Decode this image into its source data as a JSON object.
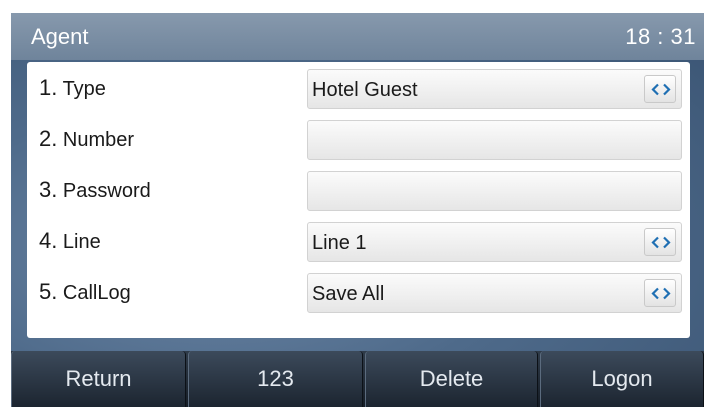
{
  "header": {
    "title": "Agent",
    "time": "18 : 31"
  },
  "rows": [
    {
      "num": "1.",
      "label": "Type",
      "value": "Hotel Guest",
      "has_switch": true,
      "switch_icon": "left-right-arrows-icon"
    },
    {
      "num": "2.",
      "label": "Number",
      "value": "",
      "has_switch": false
    },
    {
      "num": "3.",
      "label": "Password",
      "value": "",
      "has_switch": false
    },
    {
      "num": "4.",
      "label": "Line",
      "value": "Line 1",
      "has_switch": true,
      "switch_icon": "left-right-arrows-icon"
    },
    {
      "num": "5.",
      "label": "CallLog",
      "value": "Save All",
      "has_switch": true,
      "switch_icon": "left-right-arrows-icon"
    }
  ],
  "softkeys": [
    {
      "label": "Return"
    },
    {
      "label": "123"
    },
    {
      "label": "Delete"
    },
    {
      "label": "Logon"
    }
  ],
  "colors": {
    "title_bar": "#7a8ea4",
    "background": "#4e6a8a",
    "switch_arrow": "#1f6fb3",
    "softkey_bar": "#1c2530"
  }
}
